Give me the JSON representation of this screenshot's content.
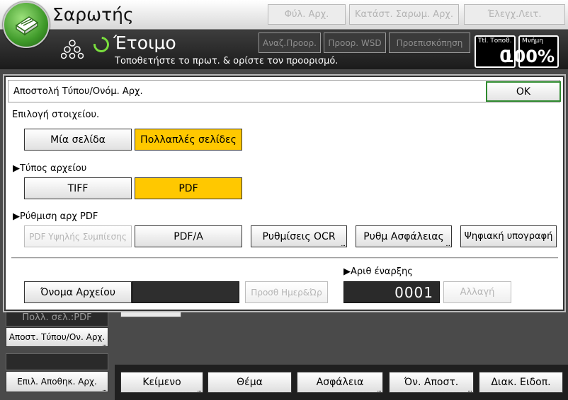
{
  "header": {
    "app_title": "Σαρωτής",
    "buttons": [
      "Φύλ. Αρχ.",
      "Κατάστ. Σαρωμ. Αρχ.",
      "Έλεγχ.Λειτ."
    ]
  },
  "status": {
    "state": "Έτοιμο",
    "instruction": "Τοποθετήστε το πρωτ. & ορίστε τον προορισμό.",
    "buttons": [
      "Αναζ.Προορ.",
      "Προορ. WSD",
      "Προεπισκόπηση"
    ],
    "total_dest": {
      "label": "Ttl. Τοποθ.",
      "value": "0"
    },
    "memory": {
      "label": "Μνήμη",
      "value": "100%"
    }
  },
  "left_panel": {
    "summary": "Πολλ. σελ.:PDF",
    "send_type_button": "Αποστ. Τύπου/Ον. Αρχ.",
    "store_button": "Επιλ. Αποθηκ. Αρχ."
  },
  "bottom_tabs": [
    "Κείμενο",
    "Θέμα",
    "Ασφάλεια",
    "Όν. Αποστ.",
    "Διακ. Ειδοπ."
  ],
  "dialog": {
    "title": "Αποστολή Τύπου/Ονόμ. Αρχ.",
    "ok": "OK",
    "select_label": "Επιλογή στοιχείου.",
    "pages": {
      "single": "Μία σελίδα",
      "multi": "Πολλαπλές σελίδες"
    },
    "file_type_label": "▶Τύπος αρχείου",
    "file_types": {
      "tiff": "TIFF",
      "pdf": "PDF"
    },
    "pdf_settings_label": "▶Ρύθμιση αρχ PDF",
    "pdf_buttons": {
      "high_compression": "PDF Υψηλής Συμπίεσης",
      "pdfa": "PDF/A",
      "ocr": "Ρυθμίσεις OCR",
      "security": "Ρυθμ Ασφάλειας",
      "signature": "Ψηφιακή υπογραφή"
    },
    "file_name_button": "Όνομα Αρχείου",
    "file_name_value": "",
    "add_datetime_button": "Προσθ Ημερ&Ώρ",
    "start_number_label": "▶Αριθ έναρξης",
    "start_number_value": "0001",
    "change_button": "Αλλαγή"
  },
  "colors": {
    "selected": "#ffc800",
    "ok_border": "#2f8a2f",
    "ready": "#7adf3e"
  },
  "icons": [
    "scanner-logo-icon",
    "molecule-icon",
    "ready-ring-icon"
  ]
}
